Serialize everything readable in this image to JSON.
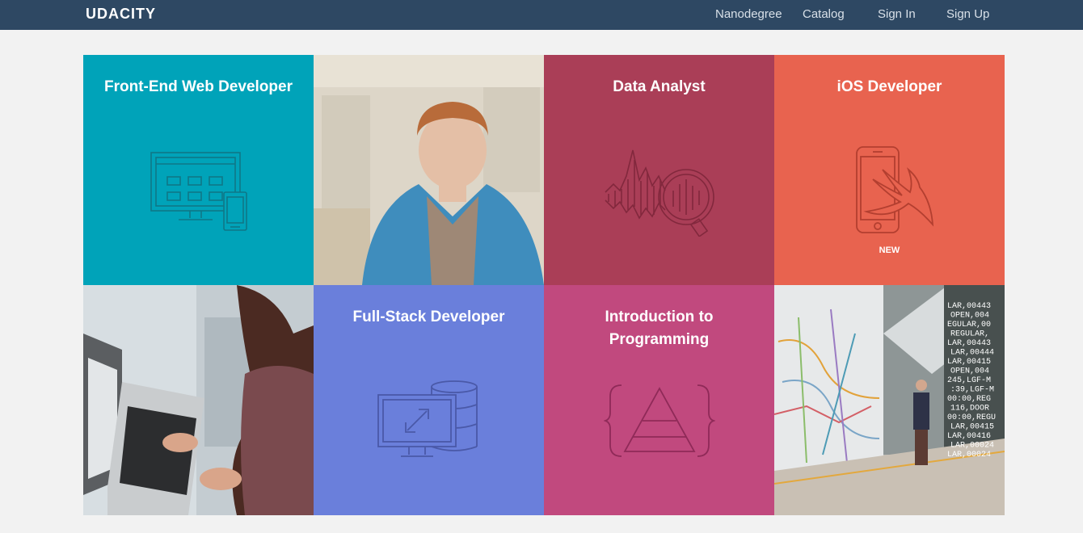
{
  "header": {
    "logo": "UDACITY",
    "nav": [
      "Nanodegree",
      "Catalog",
      "Sign In",
      "Sign Up"
    ]
  },
  "tiles": {
    "frontend": {
      "title": "Front-End Web Developer",
      "color": "#00a3b9"
    },
    "data": {
      "title": "Data Analyst",
      "color": "#aa3e57"
    },
    "ios": {
      "title": "iOS Developer",
      "color": "#e8634f",
      "badge": "NEW"
    },
    "fullstack": {
      "title": "Full-Stack Developer",
      "color": "#6a7fdb"
    },
    "intro": {
      "title_line1": "Introduction to",
      "title_line2": "Programming",
      "color": "#c1497e"
    }
  },
  "photo_code_text": [
    "LAR,00443",
    "OPEN,004",
    "EGULAR,00",
    "REGULAR,",
    "LAR,00443",
    "LAR,00444",
    "LAR,00415",
    "OPEN,004",
    "245,LGF-M",
    ":39,LGF-M",
    "00:00,REG",
    "116,DOOR",
    "00:00,REGU",
    "LAR,00415",
    "LAR,00416",
    "LAR,00024",
    "LAR,00024"
  ],
  "icons": {
    "frontend": "monitor-tablet-icon",
    "data": "chart-magnifier-icon",
    "ios": "phone-swift-icon",
    "fullstack": "monitor-database-icon",
    "intro": "braces-triangle-icon"
  }
}
